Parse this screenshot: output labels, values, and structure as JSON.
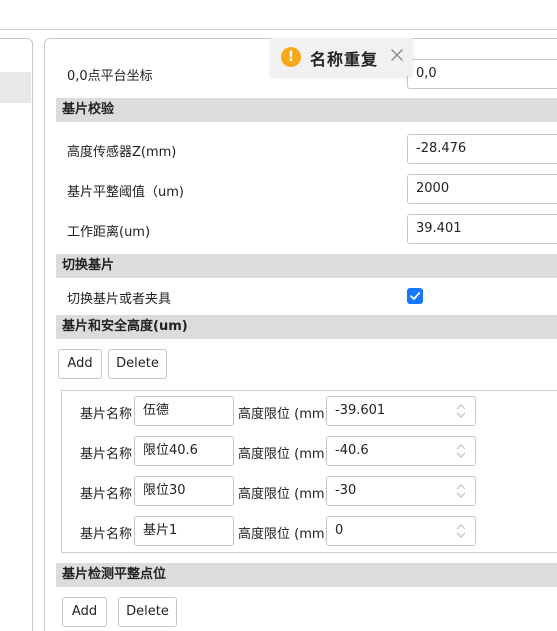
{
  "toast": {
    "title": "名称重复",
    "icon": "warning-icon",
    "color": "#f7a91b"
  },
  "row_origin": {
    "label": "0,0点平台坐标",
    "value": "0,0"
  },
  "sec_calib": {
    "title": "基片校验"
  },
  "calib": [
    {
      "label": "高度传感器Z(mm)",
      "value": "-28.476"
    },
    {
      "label": "基片平整阈值（um)",
      "value": "2000"
    },
    {
      "label": "工作距离(um)",
      "value": "39.401"
    }
  ],
  "sec_switch": {
    "title": "切换基片"
  },
  "switch_row": {
    "label": "切换基片或者夹具",
    "checked": true
  },
  "sec_height": {
    "title": "基片和安全高度(um)"
  },
  "buttons": {
    "add": "Add",
    "delete": "Delete"
  },
  "height_rows": [
    {
      "name_label": "基片名称",
      "name": "伍德",
      "limit_label": "高度限位 (mm)",
      "limit": "-39.601"
    },
    {
      "name_label": "基片名称",
      "name": "限位40.6",
      "limit_label": "高度限位 (mm)",
      "limit": "-40.6"
    },
    {
      "name_label": "基片名称",
      "name": "限位30",
      "limit_label": "高度限位 (mm)",
      "limit": "-30"
    },
    {
      "name_label": "基片名称",
      "name": "基片1",
      "limit_label": "高度限位 (mm)",
      "limit": "0"
    }
  ],
  "sec_flat": {
    "title": "基片检测平整点位"
  },
  "colors": {
    "accent": "#1677ff",
    "section_bg": "#dcdcdc",
    "border": "#c6c6c6"
  }
}
